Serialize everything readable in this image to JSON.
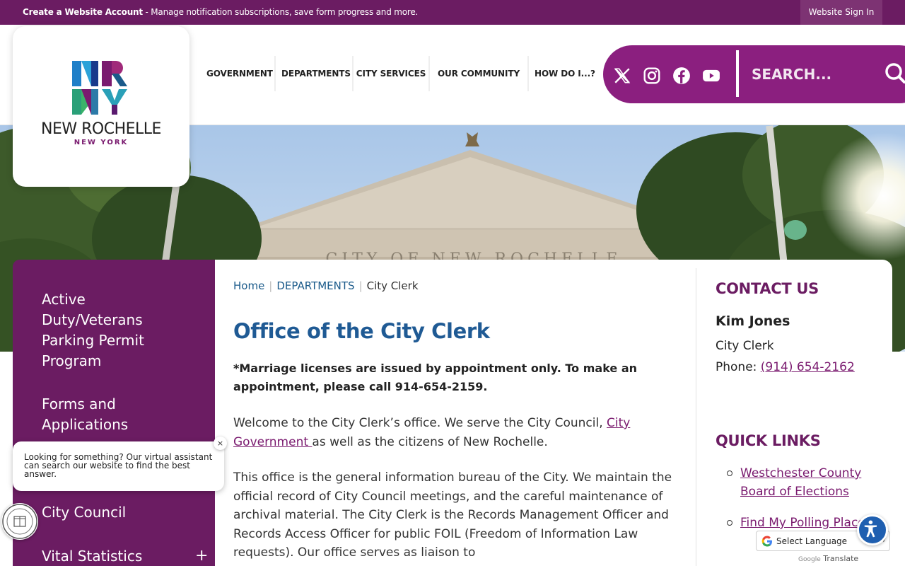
{
  "topbar": {
    "create_account_bold": "Create a Website Account",
    "create_account_rest": " - Manage notification subscriptions, save form progress and more.",
    "sign_in": "Website Sign In"
  },
  "logo": {
    "line1": "NEW ROCHELLE",
    "line2": "NEW YORK"
  },
  "nav": {
    "items": [
      "GOVERNMENT",
      "DEPARTMENTS",
      "CITY SERVICES",
      "OUR COMMUNITY",
      "HOW DO I...?"
    ]
  },
  "social": {
    "icons": [
      "x-icon",
      "instagram-icon",
      "facebook-icon",
      "youtube-icon"
    ]
  },
  "search": {
    "placeholder": "SEARCH..."
  },
  "hero": {
    "inscription": "CITY OF NEW ROCHELLE"
  },
  "sidebar": {
    "items": [
      "Active Duty/Veterans Parking Permit Program",
      "Forms and Applications",
      "City Council",
      "Vital Statistics"
    ],
    "expand_symbol": "+"
  },
  "chat": {
    "message": "Looking for something? Our virtual assistant can search our website to find the best answer.",
    "close": "×"
  },
  "breadcrumb": {
    "home": "Home",
    "departments": "DEPARTMENTS",
    "current": "City Clerk"
  },
  "main": {
    "title": "Office of the City Clerk",
    "notice": "*Marriage licenses are issued by appointment only. To make an appointment, please call 914-654-2159.",
    "p1_before": "Welcome to the City Clerk’s office. We serve the City Council, ",
    "p1_link": "City Government ",
    "p1_after": "as well as the citizens of New Rochelle.",
    "p2": "This office is the general information bureau of the City. We maintain the official record of City Council meetings, and the careful maintenance of archival material. The City Clerk is the Records Management Officer and Records Access Officer for public FOIL (Freedom of Information Law requests). Our office serves as liaison to"
  },
  "contact": {
    "heading": "CONTACT US",
    "name": "Kim Jones",
    "title": "City Clerk",
    "phone_label": "Phone: ",
    "phone": "(914) 654-2162"
  },
  "quick_links": {
    "heading": "QUICK LINKS",
    "items": [
      "Westchester County Board of Elections",
      "Find My Polling Place at"
    ]
  },
  "translate": {
    "select": "Select Language",
    "powered_by": "Google",
    "translate": "Translate"
  },
  "colors": {
    "brand_purple": "#6b1c62",
    "social_bar": "#8b1f7f",
    "title_blue": "#1f5a94",
    "link_purple": "#7a1a6f"
  }
}
